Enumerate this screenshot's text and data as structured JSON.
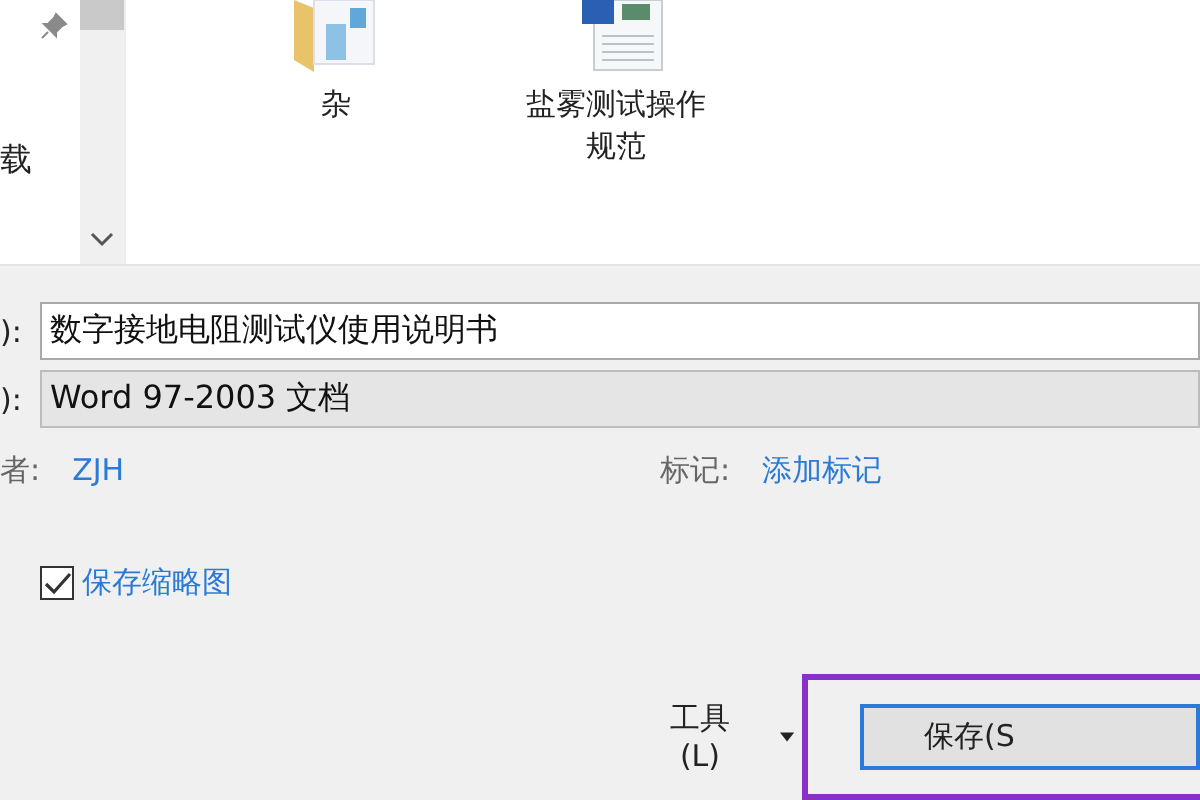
{
  "nav_pane": {
    "items": [
      "载"
    ]
  },
  "files": [
    {
      "kind": "folder",
      "name": "杂"
    },
    {
      "kind": "word",
      "name": "盐雾测试操作规范"
    }
  ],
  "filename_field": {
    "label": "):",
    "value": "数字接地电阻测试仪使用说明书"
  },
  "filetype_field": {
    "label": "):",
    "value": "Word 97-2003 文档"
  },
  "author": {
    "label": "者:",
    "value": "ZJH"
  },
  "tags": {
    "label": "标记:",
    "value": "添加标记"
  },
  "thumbnail_checkbox": {
    "label": "保存缩略图",
    "checked": true
  },
  "tools_button": {
    "label": "工具(L)"
  },
  "save_button": {
    "label": "保存(S",
    "highlighted": true
  }
}
